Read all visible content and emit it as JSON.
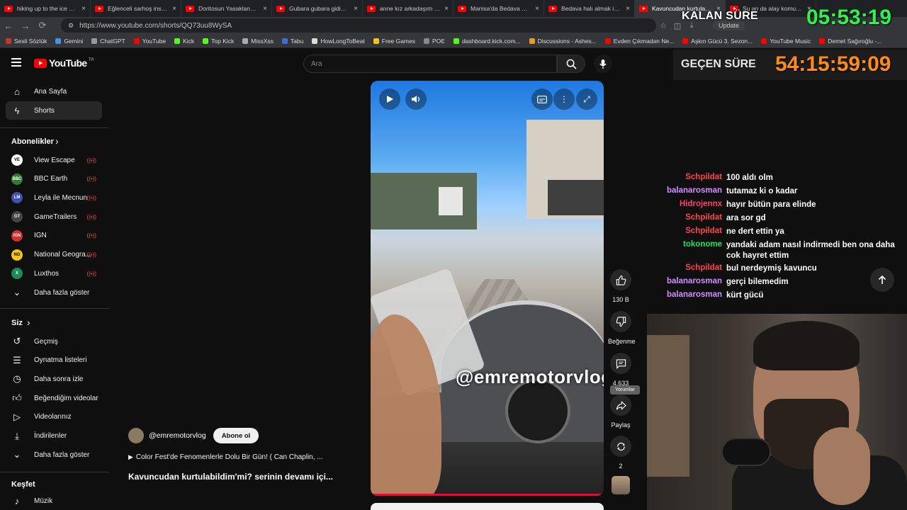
{
  "browser": {
    "tabs": [
      {
        "title": "hiking up to the ice cave"
      },
      {
        "title": "Eğlenceli sarhoş insanlar"
      },
      {
        "title": "Doritosun Yasaklanan Pu"
      },
      {
        "title": "Gubara gubara gidiyom"
      },
      {
        "title": "anne kız arkadaşım nere"
      },
      {
        "title": "Manisa'da Bedava Mesa"
      },
      {
        "title": "Bedava halı almak isteye"
      },
      {
        "title": "Kavuncudan kurtulabildi",
        "active": true
      },
      {
        "title": "Şu an da alay komutan"
      }
    ],
    "url": "https://www.youtube.com/shorts/QQ73uu8WySA",
    "update_label": "Update",
    "bookmarks": [
      {
        "label": "Sesli Sözlük",
        "color": "#c0392b"
      },
      {
        "label": "Gemini",
        "color": "#4a90e2"
      },
      {
        "label": "ChatGPT",
        "color": "#999999"
      },
      {
        "label": "YouTube",
        "color": "#ff0000"
      },
      {
        "label": "Kick",
        "color": "#53fc18"
      },
      {
        "label": "Top Kick",
        "color": "#53fc18"
      },
      {
        "label": "MissXss",
        "color": "#aaaaaa"
      },
      {
        "label": "Tabu",
        "color": "#3b6fd8"
      },
      {
        "label": "HowLongToBeat",
        "color": "#dddddd"
      },
      {
        "label": "Free Games",
        "color": "#f0c419"
      },
      {
        "label": "POE",
        "color": "#888888"
      },
      {
        "label": "dashboard.kick.com...",
        "color": "#53fc18"
      },
      {
        "label": "Discussions - Ashes...",
        "color": "#e69b2a"
      },
      {
        "label": "Evden Çıkmadan Ne...",
        "color": "#ff0000"
      },
      {
        "label": "Aşkın Gücü 3. Sezon...",
        "color": "#ff0000"
      },
      {
        "label": "YouTube Music",
        "color": "#ff0000"
      },
      {
        "label": "Demet Sağıroğlu -...",
        "color": "#ff0000"
      }
    ]
  },
  "youtube": {
    "logo_text": "YouTube",
    "logo_country": "TR",
    "search_placeholder": "Ara",
    "sidebar": {
      "main": [
        {
          "label": "Ana Sayfa",
          "icon": "home-icon"
        },
        {
          "label": "Shorts",
          "icon": "shorts-icon",
          "active": true
        }
      ],
      "subscriptions_heading": "Abonelikler",
      "subscriptions": [
        {
          "label": "View Escape",
          "avatar_color": "#ffffff",
          "avatar_text": "VE"
        },
        {
          "label": "BBC Earth",
          "avatar_color": "#2e7d32",
          "avatar_text": "BBC"
        },
        {
          "label": "Leyla ile Mecnun",
          "avatar_color": "#3f51b5",
          "avatar_text": "LM"
        },
        {
          "label": "GameTrailers",
          "avatar_color": "#444444",
          "avatar_text": "GT"
        },
        {
          "label": "IGN",
          "avatar_color": "#d32f2f",
          "avatar_text": "IGN"
        },
        {
          "label": "National Geogra...",
          "avatar_color": "#f5c518",
          "avatar_text": "NG"
        },
        {
          "label": "Luxthos",
          "avatar_color": "#1b8a5a",
          "avatar_text": "X"
        }
      ],
      "show_more_1": "Daha fazla göster",
      "you_heading": "Siz",
      "you_items": [
        {
          "label": "Geçmiş",
          "icon": "history-icon"
        },
        {
          "label": "Oynatma listeleri",
          "icon": "playlists-icon"
        },
        {
          "label": "Daha sonra izle",
          "icon": "watch-later-icon"
        },
        {
          "label": "Beğendiğim videolar",
          "icon": "like-icon"
        },
        {
          "label": "Videolarınız",
          "icon": "your-videos-icon"
        },
        {
          "label": "İndirilenler",
          "icon": "download-icon"
        }
      ],
      "show_more_2": "Daha fazla göster",
      "explore_heading": "Keşfet",
      "explore_items": [
        {
          "label": "Müzik",
          "icon": "music-icon"
        }
      ]
    },
    "short": {
      "watermark": "@emremotorvlog",
      "channel": "@emremotorvlog",
      "subscribe_label": "Abone ol",
      "playlist_line": "Color Fest'de Fenomenlerle Dolu Bir Gün! ( Can Chaplin, ...",
      "title": "Kavuncudan kurtulabildim'mi? serinin devamı içi...",
      "likes": "130 B",
      "dislike_label": "Beğenme",
      "comments": "4.633",
      "comments_tooltip": "Yorumlar",
      "share_label": "Paylaş",
      "remix_count": "2"
    }
  },
  "overlay": {
    "remaining_label": "KALAN SÜRE",
    "remaining_time": "05:53:19",
    "elapsed_label": "GEÇEN SÜRE",
    "elapsed_time": "54:15:59:09",
    "chat": [
      {
        "user": "Schpildat",
        "color": "#ff4545",
        "msg": "100 aldı olm"
      },
      {
        "user": "balanarosman",
        "color": "#d48cff",
        "msg": "tutamaz ki o kadar"
      },
      {
        "user": "Hidrojennx",
        "color": "#ff3d6e",
        "msg": "hayır bütün para elinde"
      },
      {
        "user": "Schpildat",
        "color": "#ff4545",
        "msg": "ara sor gd"
      },
      {
        "user": "Schpildat",
        "color": "#ff4545",
        "msg": "ne dert ettin ya"
      },
      {
        "user": "tokonome",
        "color": "#23e05a",
        "msg": "yandaki adam nasıl indirmedi ben ona daha cok hayret ettim"
      },
      {
        "user": "Schpildat",
        "color": "#ff4545",
        "msg": "bul nerdeymiş kavuncu"
      },
      {
        "user": "balanarosman",
        "color": "#d48cff",
        "msg": "gerçi bilemedim"
      },
      {
        "user": "balanarosman",
        "color": "#d48cff",
        "msg": "kürt gücü"
      }
    ]
  }
}
